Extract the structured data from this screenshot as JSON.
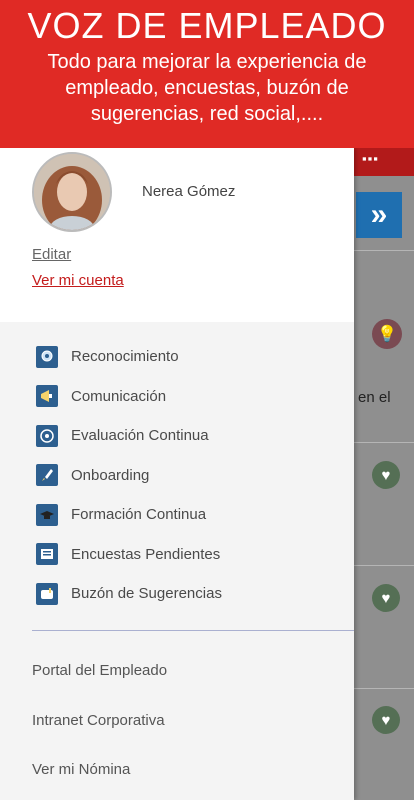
{
  "banner": {
    "title": "VOZ DE EMPLEADO",
    "subtitle": "Todo para mejorar la experiencia de empleado, encuestas, buzón de sugerencias, red social,....",
    "color": "#e02a25"
  },
  "profile": {
    "name": "Nerea Gómez",
    "edit_label": "Editar",
    "account_label": "Ver mi cuenta"
  },
  "menu": {
    "items": [
      {
        "label": "Reconocimiento",
        "icon": "award-icon"
      },
      {
        "label": "Comunicación",
        "icon": "megaphone-icon"
      },
      {
        "label": "Evaluación Continua",
        "icon": "evaluation-icon"
      },
      {
        "label": "Onboarding",
        "icon": "rocket-icon"
      },
      {
        "label": "Formación Continua",
        "icon": "graduation-cap-icon"
      },
      {
        "label": "Encuestas Pendientes",
        "icon": "survey-icon"
      },
      {
        "label": "Buzón de Sugerencias",
        "icon": "mailbox-icon"
      }
    ]
  },
  "links": {
    "items": [
      {
        "label": "Portal del Empleado"
      },
      {
        "label": "Intranet Corporativa"
      },
      {
        "label": "Ver mi Nómina"
      }
    ]
  },
  "background": {
    "partial_text": "en el",
    "accent": "#b21a1a",
    "chevron_color": "#1f6fb0"
  }
}
